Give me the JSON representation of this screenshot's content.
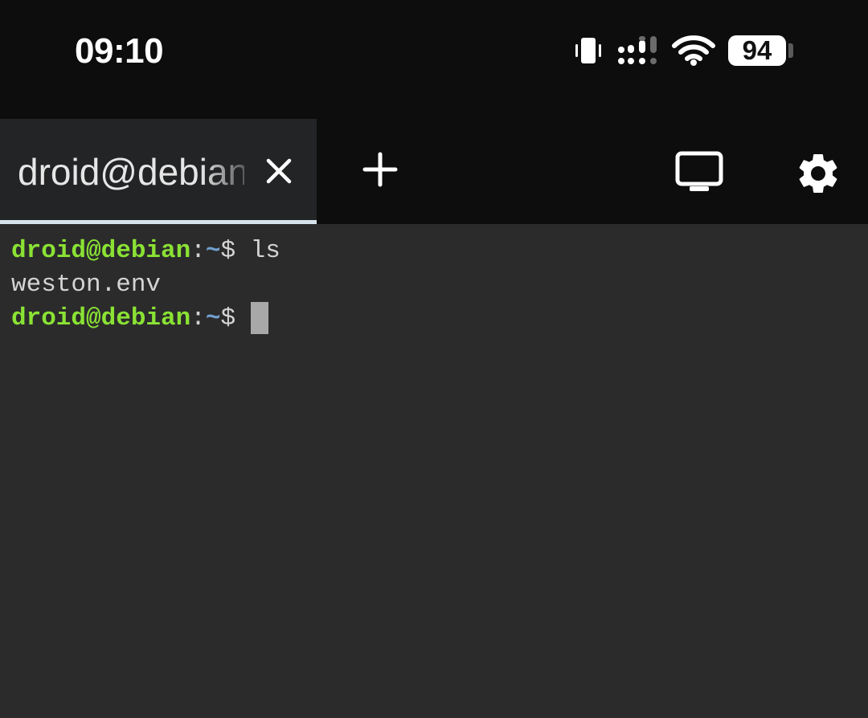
{
  "status_bar": {
    "time": "09:10",
    "battery_level": "94",
    "icons": [
      "vibrate-icon",
      "signal-icon",
      "wifi-icon",
      "battery-icon"
    ]
  },
  "tabs": [
    {
      "title": "droid@debian",
      "active": true
    }
  ],
  "toolbar": {
    "new_tab_icon": "plus-icon",
    "display_icon": "monitor-icon",
    "settings_icon": "gear-icon"
  },
  "terminal": {
    "lines": [
      {
        "user": "droid@debian",
        "colon": ":",
        "path": "~",
        "dollar": "$",
        "command": " ls"
      },
      {
        "output": "weston.env"
      },
      {
        "user": "droid@debian",
        "colon": ":",
        "path": "~",
        "dollar": "$",
        "command": " "
      }
    ]
  },
  "colors": {
    "background": "#2b2b2b",
    "bar": "#0d0d0d",
    "tab_active": "#232425",
    "tab_indicator": "#d6e3ea",
    "prompt_user": "#8ae234",
    "prompt_path": "#729fcf",
    "text": "#d4d4d4",
    "cursor": "#a8a8a8"
  }
}
